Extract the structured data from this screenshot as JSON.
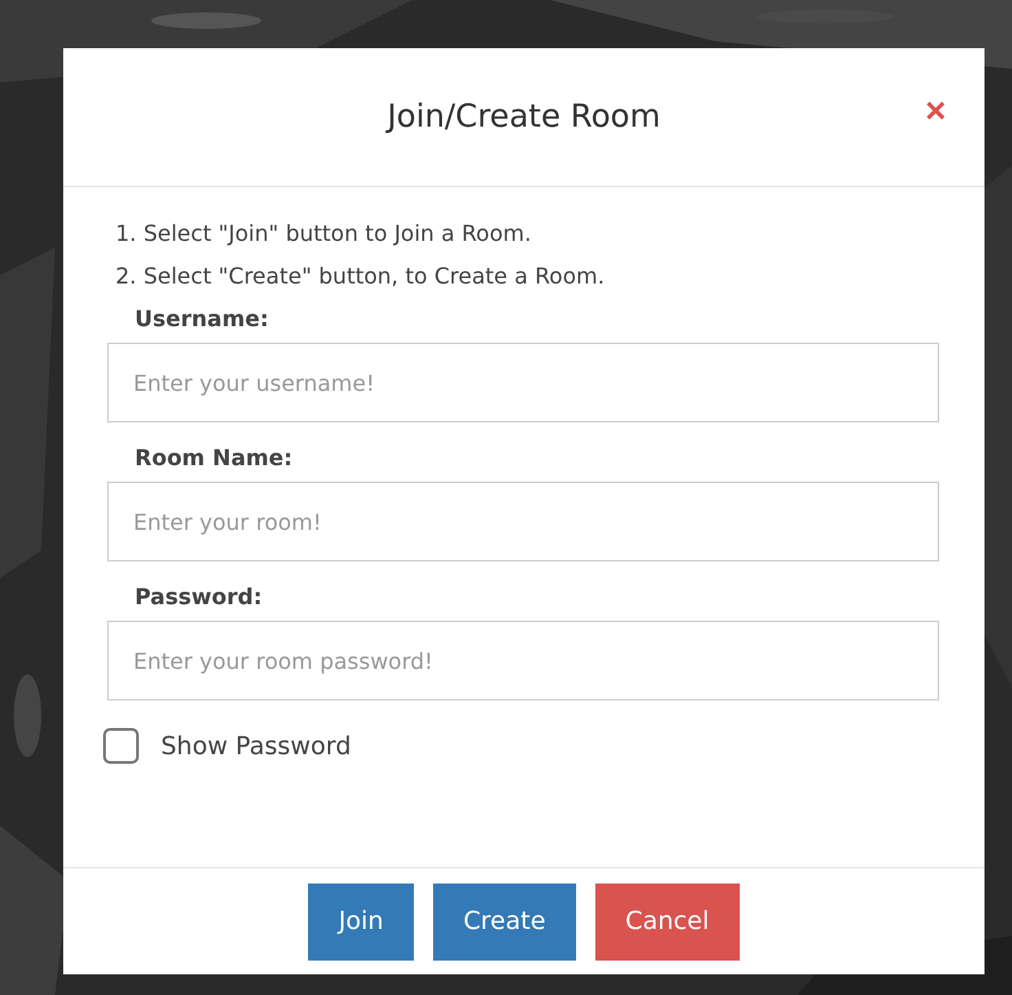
{
  "dialog": {
    "title": "Join/Create Room",
    "close": "×",
    "instructions": [
      "1. Select \"Join\" button to Join a Room.",
      "2. Select \"Create\" button, to Create a Room."
    ],
    "fields": [
      {
        "label": "Username:",
        "placeholder": "Enter your username!"
      },
      {
        "label": "Room Name:",
        "placeholder": "Enter your room!"
      },
      {
        "label": "Password:",
        "placeholder": "Enter your room password!"
      }
    ],
    "show_password": {
      "label": "Show Password",
      "checked": false
    },
    "buttons": [
      {
        "label": "Join",
        "kind": "primary"
      },
      {
        "label": "Create",
        "kind": "primary"
      },
      {
        "label": "Cancel",
        "kind": "danger"
      }
    ]
  }
}
